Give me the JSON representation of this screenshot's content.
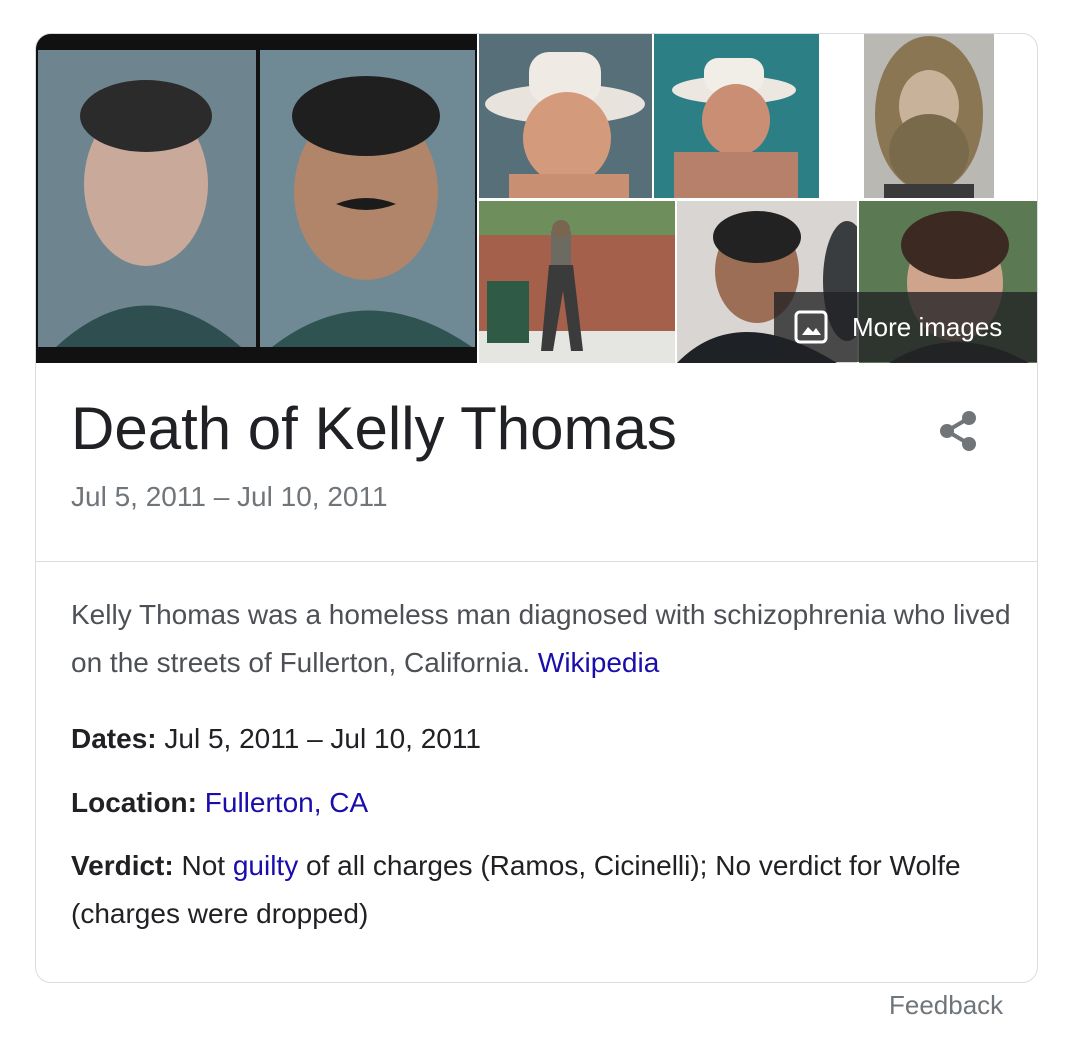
{
  "images": [
    {
      "id": "mugshots",
      "alt": "Two mugshots"
    },
    {
      "id": "cowboy-hat-1",
      "alt": "Man in cowboy hat"
    },
    {
      "id": "cowboy-hat-2",
      "alt": "Man in cowboy hat, second photo"
    },
    {
      "id": "bearded-man",
      "alt": "Bearded man with long hair"
    },
    {
      "id": "street-photo",
      "alt": "Man standing by a brick wall"
    },
    {
      "id": "courtroom",
      "alt": "Man in courtroom"
    },
    {
      "id": "portrait",
      "alt": "Portrait of a man"
    }
  ],
  "more_images_label": "More images",
  "title": "Death of Kelly Thomas",
  "subtitle": "Jul 5, 2011 – Jul 10, 2011",
  "description": {
    "text": "Kelly Thomas was a homeless man diagnosed with schizophrenia who lived on the streets of Fullerton, California.",
    "source_link": "Wikipedia"
  },
  "facts": {
    "dates": {
      "label": "Dates:",
      "value": "Jul 5, 2011 – Jul 10, 2011"
    },
    "location": {
      "label": "Location:",
      "value": "Fullerton, CA"
    },
    "verdict": {
      "label": "Verdict:",
      "before": "Not",
      "link": "guilty",
      "after": "of all charges (Ramos, Cicinelli); No verdict for Wolfe (charges were dropped)"
    }
  },
  "feedback_label": "Feedback",
  "colors": {
    "link": "#1a0dab",
    "muted": "#70757a",
    "border": "#dadce0",
    "text": "#202124"
  },
  "icons": {
    "more_images": "image-icon",
    "share": "share-icon"
  }
}
